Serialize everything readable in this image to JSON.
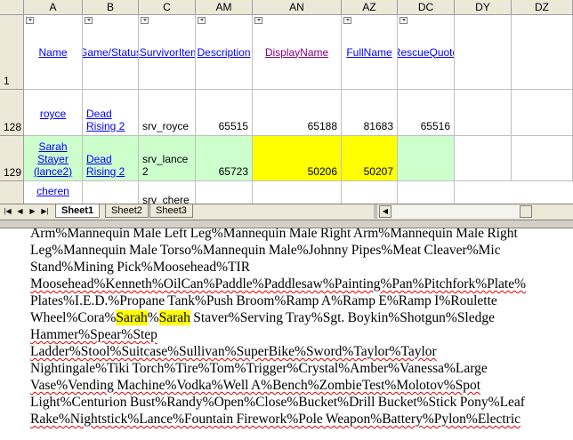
{
  "sheet": {
    "columns": [
      "A",
      "B",
      "C",
      "AM",
      "AN",
      "AZ",
      "DC",
      "DY",
      "DZ"
    ],
    "header_row": {
      "row_number": "1",
      "cells": [
        "Name",
        "Game/Status",
        "cSurvivorItem",
        "Description",
        "DisplayName",
        "FullName",
        "RescueQuote"
      ]
    },
    "rows": [
      {
        "row_number": "128",
        "name": "royce",
        "game": "Dead Rising 2",
        "item": "srv_royce",
        "am": "65515",
        "an": "65188",
        "az": "81683",
        "dc": "65516"
      },
      {
        "row_number": "129",
        "name": "Sarah Stayer (lance2)",
        "game": "Dead Rising 2",
        "item": "srv_lance 2",
        "am": "65723",
        "an": "50206",
        "az": "50207",
        "dc": ""
      },
      {
        "row_number": "",
        "name": "cheren",
        "game": "",
        "item": "srv_chere",
        "am": "",
        "an": "",
        "az": "",
        "dc": ""
      }
    ],
    "tabs": [
      "Sheet1",
      "Sheet2",
      "Sheet3"
    ],
    "colors": {
      "highlight_green": "#ccffcc",
      "highlight_yellow": "#ffff00",
      "link": "#0000ff"
    }
  },
  "doc": {
    "lines": [
      "Arm%Mannequin Male Left Leg%Mannequin Male Right Arm%Mannequin Male Right",
      "Leg%Mannequin Male Torso%Mannequin Male%Johnny Pipes%Meat Cleaver%Mic",
      "Stand%Mining Pick%Moosehead%TIR",
      "Moosehead%Kenneth%OilCan%Paddle%Paddlesaw%Painting%Pan%Pitchfork%Plate%",
      "Plates%I.E.D.%Propane Tank%Push Broom%Ramp A%Ramp E%Ramp I%Roulette",
      "Wheel%Cora%Sarah%Sarah Staver%Serving Tray%Sgt. Boykin%Shotgun%Sledge",
      "Hammer%Spear%Step",
      "Ladder%Stool%Suitcase%Sullivan%SuperBike%Sword%Taylor%Taylor",
      "Nightingale%Tiki Torch%Tire%Tom%Trigger%Crystal%Amber%Vanessa%Large",
      "Vase%Vending Machine%Vodka%Well A%Bench%ZombieTest%Molotov%Spot",
      "Light%Centurion Bust%Randy%Open%Close%Bucket%Drill Bucket%Stick Pony%Leaf",
      "Rake%Nightstick%Lance%Fountain Firework%Pole Weapon%Battery%Pylon%Electric"
    ]
  }
}
